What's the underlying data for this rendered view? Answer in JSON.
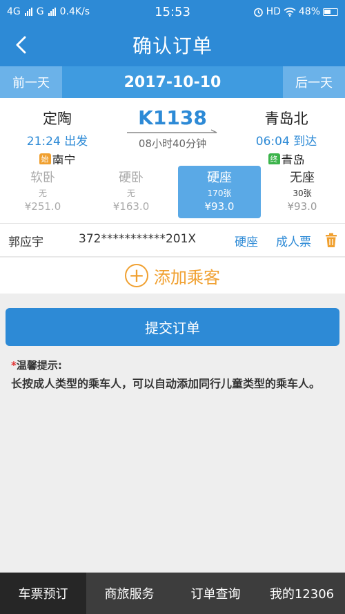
{
  "status_bar": {
    "network_left": "4G",
    "network_right": "G",
    "speed": "0.4K/s",
    "time": "15:53",
    "hd": "HD",
    "battery": "48%"
  },
  "header": {
    "title": "确认订单"
  },
  "date_bar": {
    "prev": "前一天",
    "current": "2017-10-10",
    "next": "后一天"
  },
  "train": {
    "from": {
      "station": "定陶",
      "time": "21:24 出发",
      "tag": "始",
      "terminal": "南宁"
    },
    "to": {
      "station": "青岛北",
      "time": "06:04 到达",
      "tag": "终",
      "terminal": "青岛"
    },
    "number": "K1138",
    "duration": "08小时40分钟"
  },
  "seats": [
    {
      "type": "软卧",
      "count": "无",
      "price": "¥251.0"
    },
    {
      "type": "硬卧",
      "count": "无",
      "price": "¥163.0"
    },
    {
      "type": "硬座",
      "count": "170张",
      "price": "¥93.0"
    },
    {
      "type": "无座",
      "count": "30张",
      "price": "¥93.0"
    }
  ],
  "passenger": {
    "name": "郭应宇",
    "id": "372***********201X",
    "seat": "硬座",
    "ticket_type": "成人票"
  },
  "add_passenger": {
    "label": "添加乘客"
  },
  "submit": {
    "label": "提交订单"
  },
  "tips": {
    "title": "温馨提示:",
    "text": "长按成人类型的乘车人，可以自动添加同行儿童类型的乘车人。"
  },
  "bottom_nav": [
    "车票预订",
    "商旅服务",
    "订单查询",
    "我的12306"
  ],
  "colors": {
    "primary": "#2d8ad6",
    "accent": "#f0a030",
    "selected_seat": "#5aa9e6"
  }
}
